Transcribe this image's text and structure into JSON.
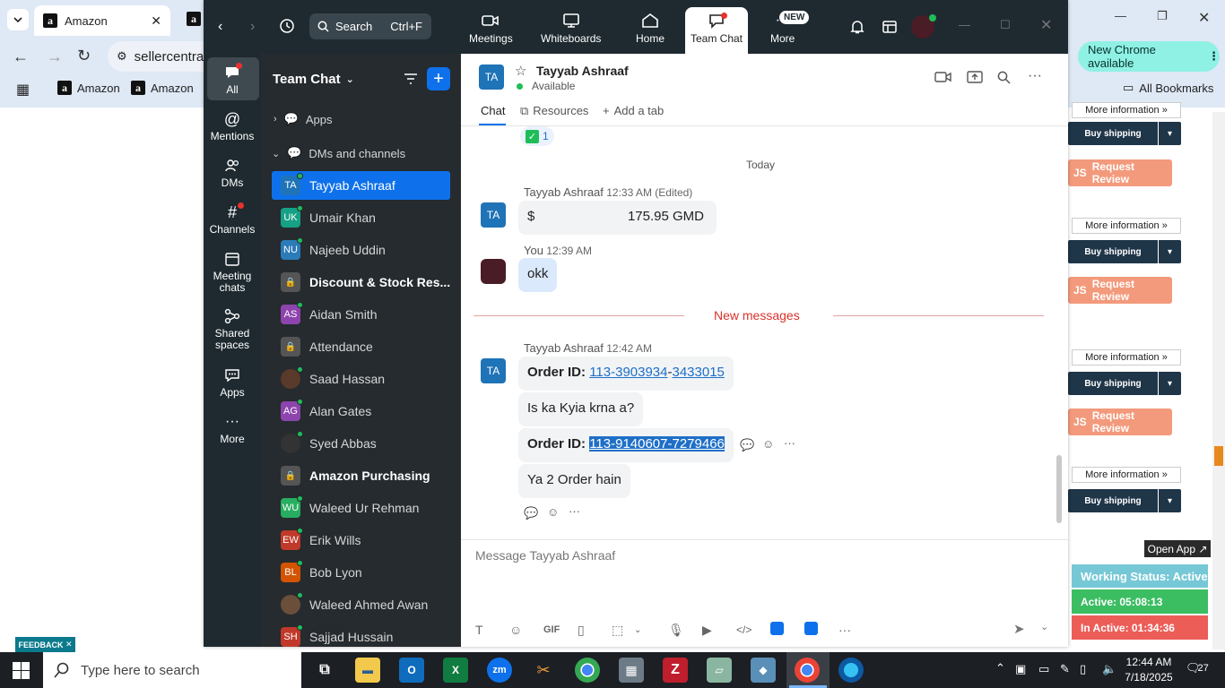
{
  "browser": {
    "tabs": [
      {
        "title": "Amazon"
      }
    ],
    "address": "sellercentra",
    "bookmarks": [
      "Amazon",
      "Amazon"
    ],
    "all_bookmarks": "All Bookmarks",
    "new_chrome": "New Chrome available"
  },
  "seller_page": {
    "more_info": "More information »",
    "buy_shipping": "Buy shipping",
    "request_review": "Request Review",
    "js": "JS",
    "feedback": "FEEDBACK"
  },
  "zoom": {
    "search_label": "Search",
    "search_shortcut": "Ctrl+F",
    "top_nav": [
      {
        "label": "Meetings",
        "icon": "video-camera-icon"
      },
      {
        "label": "Whiteboards",
        "icon": "whiteboard-icon"
      },
      {
        "label": "Home",
        "icon": "home-icon"
      },
      {
        "label": "Team Chat",
        "icon": "chat-bubble-icon"
      },
      {
        "label": "More",
        "icon": "ellipsis-icon",
        "badge": "NEW"
      }
    ],
    "rail": [
      {
        "label": "All",
        "icon": "chat-icon"
      },
      {
        "label": "Mentions",
        "icon": "at-icon"
      },
      {
        "label": "DMs",
        "icon": "people-icon"
      },
      {
        "label": "Channels",
        "icon": "hashtag-icon"
      },
      {
        "label": "Meeting chats",
        "icon": "calendar-icon"
      },
      {
        "label": "Shared spaces",
        "icon": "shared-icon"
      },
      {
        "label": "Apps",
        "icon": "apps-icon"
      },
      {
        "label": "More",
        "icon": "more-icon"
      }
    ],
    "list_title": "Team Chat",
    "apps_section": "Apps",
    "dm_section": "DMs and channels",
    "contacts": [
      {
        "initials": "TA",
        "name": "Tayyab Ashraaf",
        "color": "#1f73b7"
      },
      {
        "initials": "UK",
        "name": "Umair Khan",
        "color": "#16a085"
      },
      {
        "initials": "NU",
        "name": "Najeeb Uddin",
        "color": "#2b7bb9"
      },
      {
        "initials": "",
        "name": "Discount & Stock Res...",
        "color": "#555"
      },
      {
        "initials": "AS",
        "name": "Aidan Smith",
        "color": "#8e44ad"
      },
      {
        "initials": "",
        "name": "Attendance",
        "color": "#555"
      },
      {
        "initials": "",
        "name": "Saad Hassan",
        "color": "#5a3a2a"
      },
      {
        "initials": "AG",
        "name": "Alan Gates",
        "color": "#8e44ad"
      },
      {
        "initials": "",
        "name": "Syed Abbas",
        "color": "#333"
      },
      {
        "initials": "",
        "name": "Amazon Purchasing",
        "color": "#555"
      },
      {
        "initials": "WU",
        "name": "Waleed Ur Rehman",
        "color": "#27ae60"
      },
      {
        "initials": "EW",
        "name": "Erik Wills",
        "color": "#c0392b"
      },
      {
        "initials": "BL",
        "name": "Bob Lyon",
        "color": "#d35400"
      },
      {
        "initials": "",
        "name": "Waleed Ahmed Awan",
        "color": "#6b4f3a"
      },
      {
        "initials": "SH",
        "name": "Sajjad Hussain",
        "color": "#c0392b"
      }
    ],
    "chat": {
      "contact_initials": "TA",
      "contact_name": "Tayyab Ashraaf",
      "status": "Available",
      "tabs": [
        "Chat",
        "Resources",
        "Add a tab"
      ],
      "reaction_count": "1",
      "day_divider": "Today",
      "new_messages": "New messages",
      "messages": [
        {
          "sender": "Tayyab Ashraaf",
          "time": "12:33 AM",
          "edited": "(Edited)",
          "currency": "$",
          "amount": "175.95 GMD"
        },
        {
          "sender": "You",
          "time": "12:39 AM",
          "text": "okk"
        },
        {
          "sender": "Tayyab Ashraaf",
          "time": "12:42 AM"
        }
      ],
      "order_label": "Order ID:",
      "order1": {
        "a": "113-3903934",
        "b": "3433015"
      },
      "text1": "Is ka Kyia krna a?",
      "order2": {
        "a": "113-9140607",
        "b": "7279466"
      },
      "text2": "Ya 2 Order hain",
      "composer_placeholder": "Message Tayyab Ashraaf"
    }
  },
  "tracker": {
    "open_app": "Open App ↗",
    "working_status": "Working Status: Active",
    "active": "Active: 05:08:13",
    "inactive": "In Active: 01:34:36"
  },
  "taskbar": {
    "search_placeholder": "Type here to search",
    "time": "12:44 AM",
    "date": "7/18/2025",
    "notifications": "27"
  }
}
